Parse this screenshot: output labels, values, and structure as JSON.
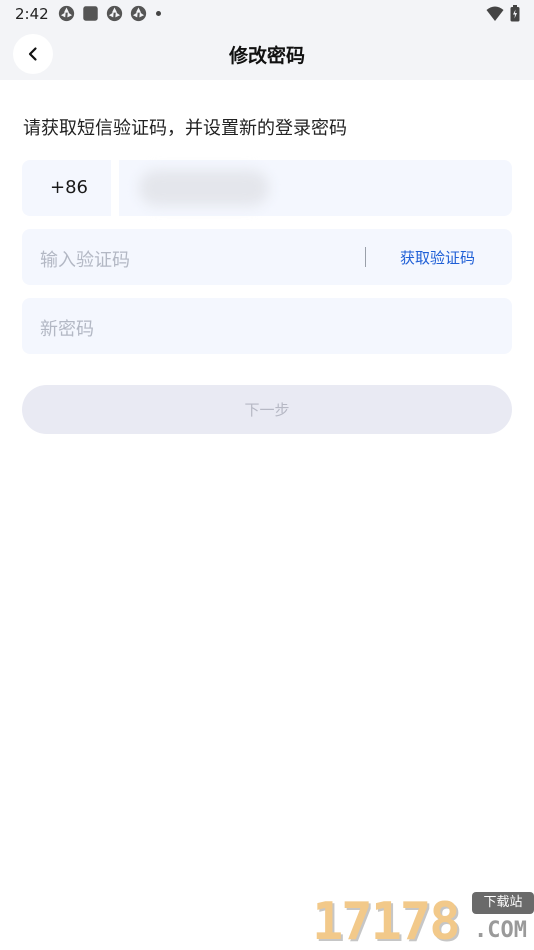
{
  "status_bar": {
    "time": "2:42",
    "icons": [
      "aperture-icon",
      "square-icon",
      "aperture-icon",
      "aperture-icon",
      "notification-dot-icon"
    ],
    "right_icons": [
      "wifi-icon",
      "battery-icon"
    ]
  },
  "nav": {
    "title": "修改密码",
    "back_icon": "chevron-left-icon"
  },
  "form": {
    "instruction": "请获取短信验证码，并设置新的登录密码",
    "country_code": "+86",
    "phone_value": "",
    "code_placeholder": "输入验证码",
    "get_code_label": "获取验证码",
    "password_placeholder": "新密码",
    "next_label": "下一步"
  },
  "colors": {
    "header_bg": "#f3f4f7",
    "field_bg": "#f4f7fe",
    "link_blue": "#1f5fd6",
    "button_disabled_bg": "#e9eaf3",
    "placeholder": "#b3b8c4"
  },
  "watermark": {
    "digits": "17178",
    "badge": "下载站",
    "suffix": ".COM"
  }
}
